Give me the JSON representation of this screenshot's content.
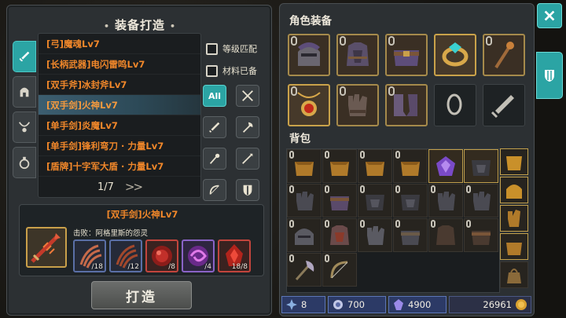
{
  "crafting": {
    "title": "装备打造",
    "recipes": [
      {
        "label": "[弓]魔魂Lv7"
      },
      {
        "label": "[长柄武器]电闪雷鸣Lv7"
      },
      {
        "label": "[双手斧]冰封斧Lv7"
      },
      {
        "label": "[双手剑]火神Lv7"
      },
      {
        "label": "[单手剑]炎魔Lv7"
      },
      {
        "label": "[单手剑]锋利弯刀 · 力量Lv7"
      },
      {
        "label": "[盾牌]十字军大盾 · 力量Lv7"
      }
    ],
    "selected_index": 3,
    "page": "1/7",
    "filters": {
      "level_match": "等级匹配",
      "materials_ready": "材料已备"
    },
    "all_label": "All",
    "detail": {
      "title": "[双手剑]火神Lv7",
      "defeat_text": "击败：阿格里斯的怨灵",
      "materials": [
        {
          "count": "/18",
          "rarity": "blue"
        },
        {
          "count": "/12",
          "rarity": "blue"
        },
        {
          "count": "/8",
          "rarity": "red"
        },
        {
          "count": "/4",
          "rarity": "purple"
        },
        {
          "count": "18/8",
          "rarity": "red"
        }
      ]
    },
    "craft_button": "打造"
  },
  "equipment": {
    "title": "角色装备",
    "slots": [
      {
        "icon": "helmet-icon",
        "filled": true
      },
      {
        "icon": "chest-armor-icon",
        "filled": true
      },
      {
        "icon": "belt-icon",
        "filled": true
      },
      {
        "icon": "amulet-ring-icon",
        "filled": true
      },
      {
        "icon": "staff-icon",
        "filled": true
      },
      {
        "icon": "fire-amulet-icon",
        "filled": true
      },
      {
        "icon": "gauntlet-icon",
        "filled": true
      },
      {
        "icon": "boots-icon",
        "filled": true
      },
      {
        "icon": "ring-slot-icon",
        "filled": false
      },
      {
        "icon": "sword-slot-icon",
        "filled": false
      }
    ]
  },
  "bag": {
    "title": "背包"
  },
  "currency": {
    "items": [
      {
        "icon": "star-gem-icon",
        "value": "8"
      },
      {
        "icon": "spirit-icon",
        "value": "700"
      },
      {
        "icon": "crystal-icon",
        "value": "4900"
      },
      {
        "icon": "gold-coin-icon",
        "value": "26961"
      }
    ]
  },
  "colors": {
    "accent": "#2ba4a4",
    "recipe_text": "#f0872a",
    "panel": "#2c3033"
  }
}
